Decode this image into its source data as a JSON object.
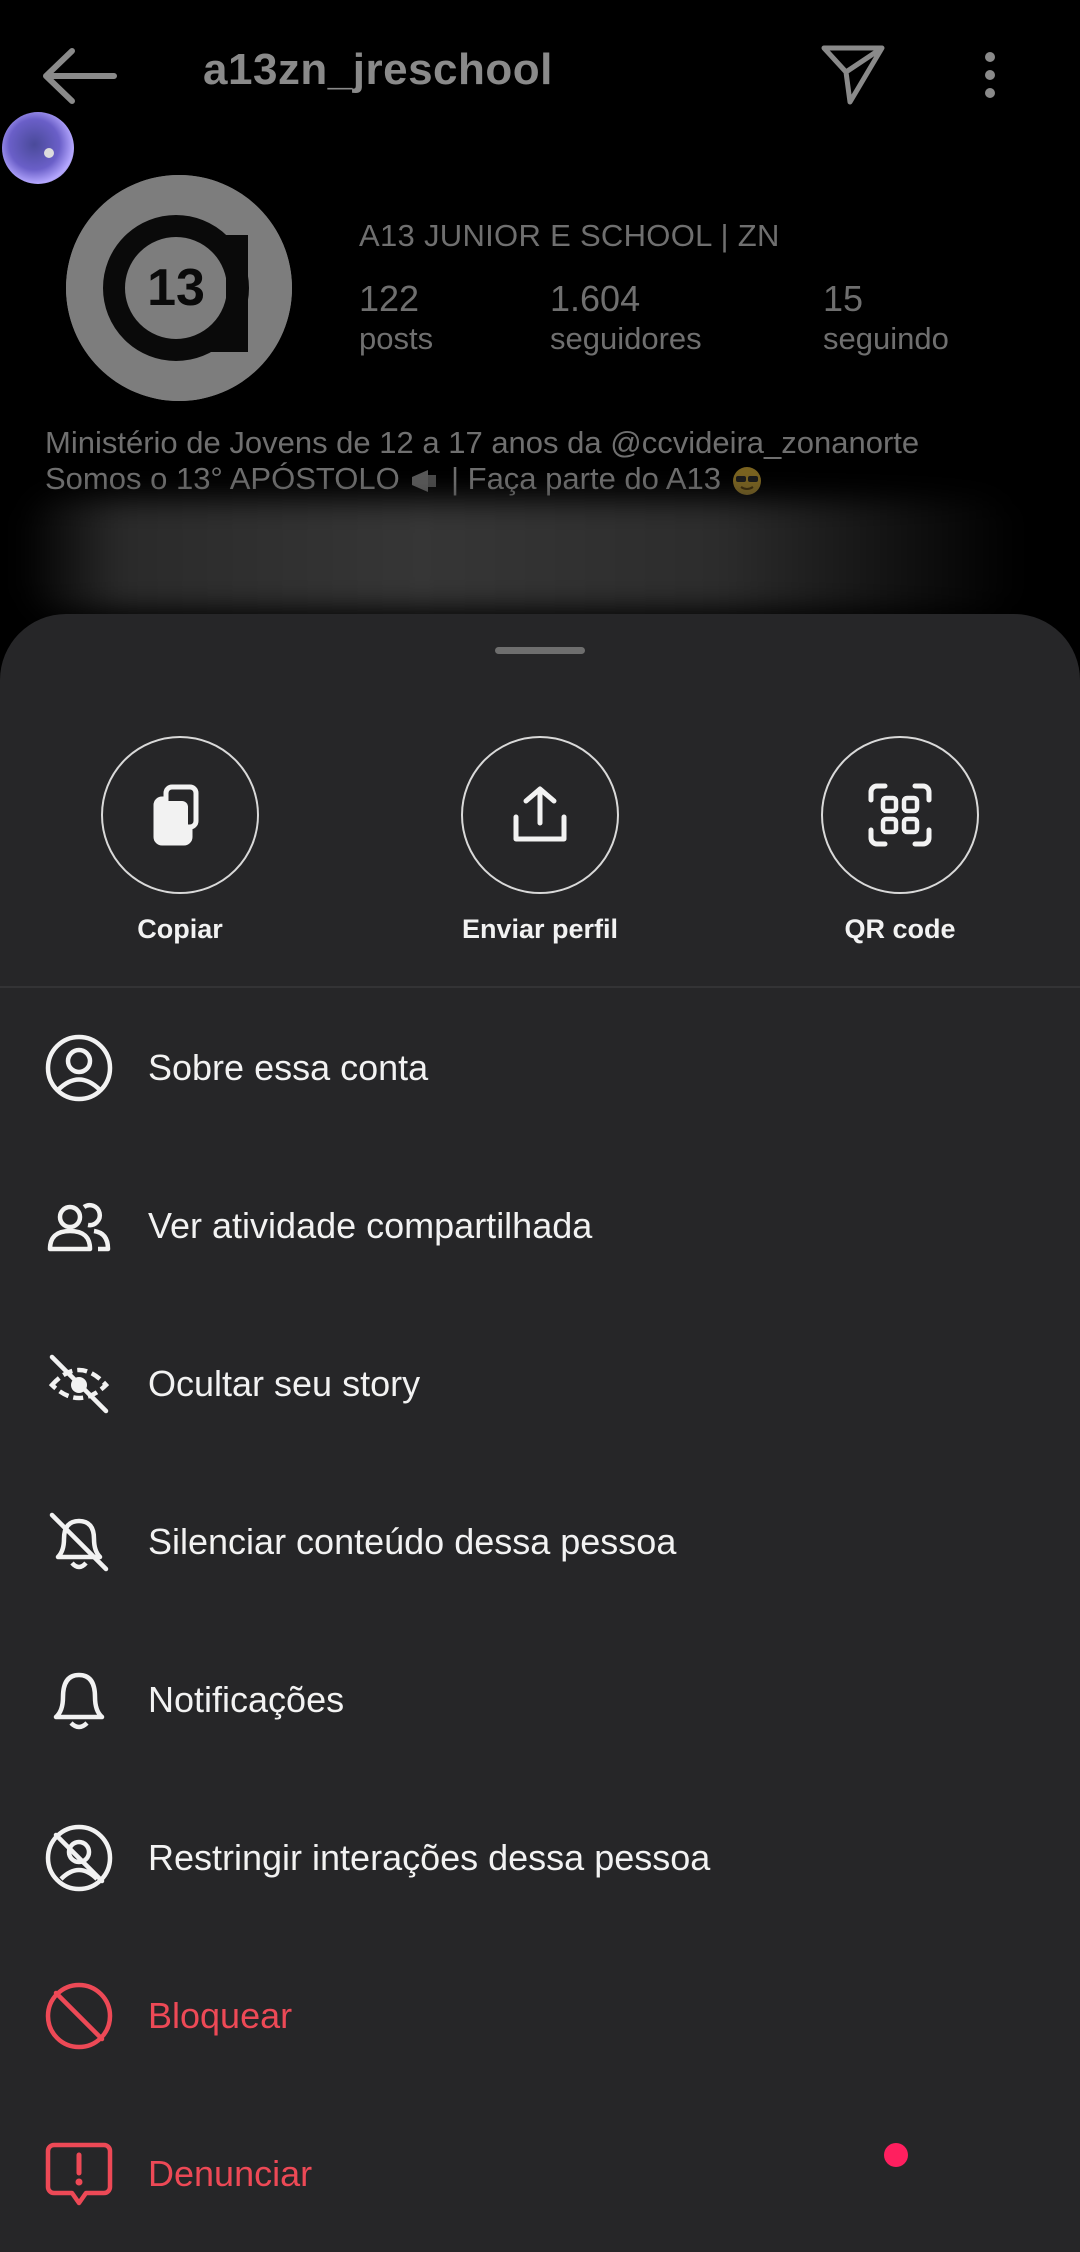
{
  "profile": {
    "username": "a13zn_jreschool",
    "display_name": "A13 JUNIOR E SCHOOL | ZN",
    "stats": [
      {
        "value": "122",
        "label": "posts"
      },
      {
        "value": "1.604",
        "label": "seguidores"
      },
      {
        "value": "15",
        "label": "seguindo"
      }
    ],
    "bio_line1": "Ministério de Jovens de 12 a 17 anos da @ccvideira_zonanorte",
    "bio_line2": "Somos o 13° APÓSTOLO",
    "bio_line2b": " | Faça parte do A13 ",
    "avatar_text": "13"
  },
  "sheet": {
    "actions": [
      {
        "label": "Copiar",
        "icon": "copy-icon"
      },
      {
        "label": "Enviar perfil",
        "icon": "share-icon"
      },
      {
        "label": "QR code",
        "icon": "qr-code-icon"
      }
    ],
    "menu": [
      {
        "label": "Sobre essa conta",
        "icon": "account-circle-icon"
      },
      {
        "label": "Ver atividade compartilhada",
        "icon": "people-icon"
      },
      {
        "label": "Ocultar seu story",
        "icon": "hide-story-icon"
      },
      {
        "label": "Silenciar conteúdo dessa pessoa",
        "icon": "mute-bell-icon"
      },
      {
        "label": "Notificações",
        "icon": "bell-icon"
      },
      {
        "label": "Restringir interações dessa pessoa",
        "icon": "restrict-icon"
      },
      {
        "label": "Bloquear",
        "icon": "block-icon"
      },
      {
        "label": "Denunciar",
        "icon": "report-icon"
      }
    ]
  },
  "colors": {
    "sheet_bg": "#262628",
    "danger": "#ed4956",
    "text": "#f2f2f2",
    "dim_text": "#6f6f6f"
  }
}
